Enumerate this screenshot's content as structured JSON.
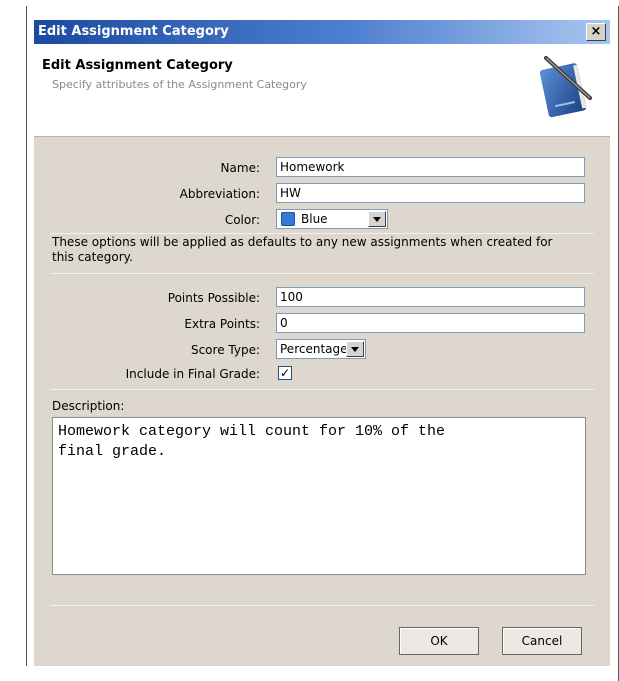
{
  "window": {
    "title": "Edit Assignment Category",
    "close_glyph": "×"
  },
  "header": {
    "title": "Edit Assignment Category",
    "subtitle": "Specify attributes of the Assignment Category",
    "icon": "notebook-pen-icon"
  },
  "form": {
    "name_label": "Name:",
    "name_value": "Homework",
    "abbr_label": "Abbreviation:",
    "abbr_value": "HW",
    "color_label": "Color:",
    "color_value": "Blue",
    "color_swatch": "#3a78d8",
    "defaults_note": "These options will be applied as defaults to any new assignments when created for this category.",
    "points_label": "Points Possible:",
    "points_value": "100",
    "extra_label": "Extra Points:",
    "extra_value": "0",
    "score_label": "Score Type:",
    "score_value": "Percentage",
    "final_label": "Include in Final Grade:",
    "final_checked": true,
    "final_check_glyph": "✓",
    "desc_label": "Description:",
    "desc_value": "Homework category will count for 10% of the\nfinal grade."
  },
  "buttons": {
    "ok": "OK",
    "cancel": "Cancel"
  },
  "colors": {
    "title_bar": "#1c4aa0",
    "panel": "#ddd7ce"
  }
}
